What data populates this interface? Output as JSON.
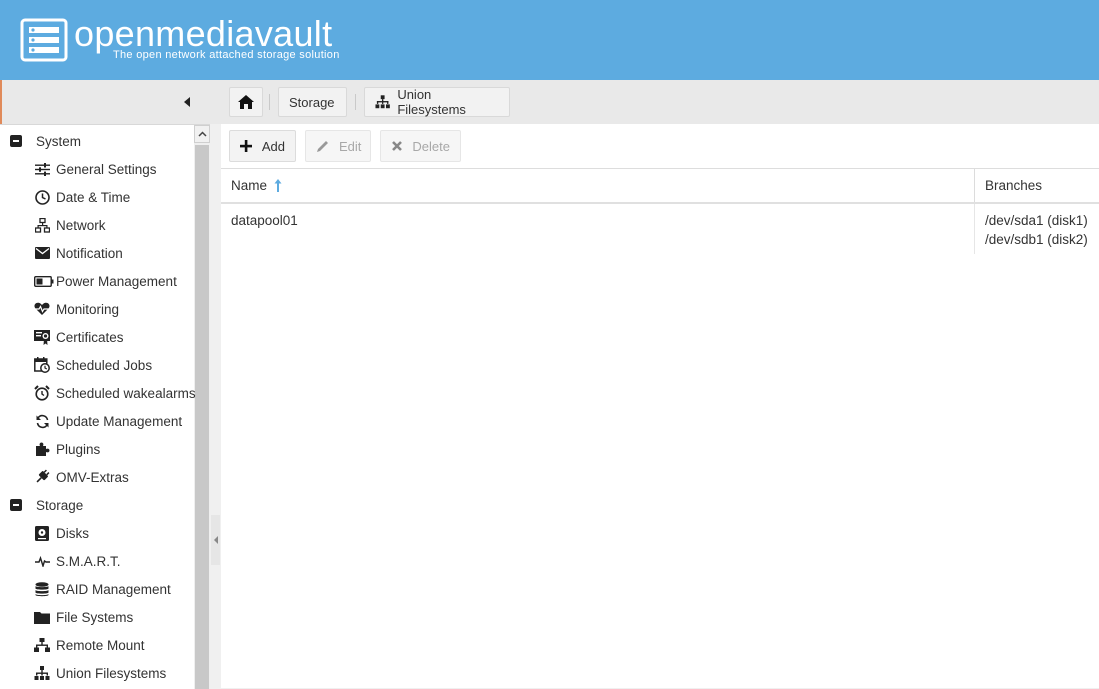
{
  "header": {
    "title": "openmediavault",
    "subtitle": "The open network attached storage solution",
    "background": "#5dabe0"
  },
  "breadcrumb": {
    "home_icon": "home-icon",
    "items": [
      "Storage",
      "Union Filesystems"
    ]
  },
  "sidebar": {
    "groups": [
      {
        "label": "System",
        "items": [
          {
            "label": "General Settings",
            "icon": "sliders-icon"
          },
          {
            "label": "Date & Time",
            "icon": "clock-icon"
          },
          {
            "label": "Network",
            "icon": "network-icon"
          },
          {
            "label": "Notification",
            "icon": "envelope-icon"
          },
          {
            "label": "Power Management",
            "icon": "battery-icon"
          },
          {
            "label": "Monitoring",
            "icon": "heartbeat-icon"
          },
          {
            "label": "Certificates",
            "icon": "certificate-icon"
          },
          {
            "label": "Scheduled Jobs",
            "icon": "calendar-clock-icon"
          },
          {
            "label": "Scheduled wakealarms",
            "icon": "alarm-icon"
          },
          {
            "label": "Update Management",
            "icon": "refresh-icon"
          },
          {
            "label": "Plugins",
            "icon": "puzzle-icon"
          },
          {
            "label": "OMV-Extras",
            "icon": "plug-icon"
          }
        ]
      },
      {
        "label": "Storage",
        "items": [
          {
            "label": "Disks",
            "icon": "disk-icon"
          },
          {
            "label": "S.M.A.R.T.",
            "icon": "pulse-icon"
          },
          {
            "label": "RAID Management",
            "icon": "database-icon"
          },
          {
            "label": "File Systems",
            "icon": "folder-icon"
          },
          {
            "label": "Remote Mount",
            "icon": "sitemap-icon"
          },
          {
            "label": "Union Filesystems",
            "icon": "sitemap-icon"
          }
        ]
      }
    ]
  },
  "toolbar": {
    "add_label": "Add",
    "edit_label": "Edit",
    "delete_label": "Delete"
  },
  "grid": {
    "columns": [
      "Name",
      "Branches"
    ],
    "sort": "Name ascending",
    "rows": [
      {
        "name": "datapool01",
        "branches": [
          "/dev/sda1 (disk1)",
          "/dev/sdb1 (disk2)"
        ]
      }
    ]
  }
}
